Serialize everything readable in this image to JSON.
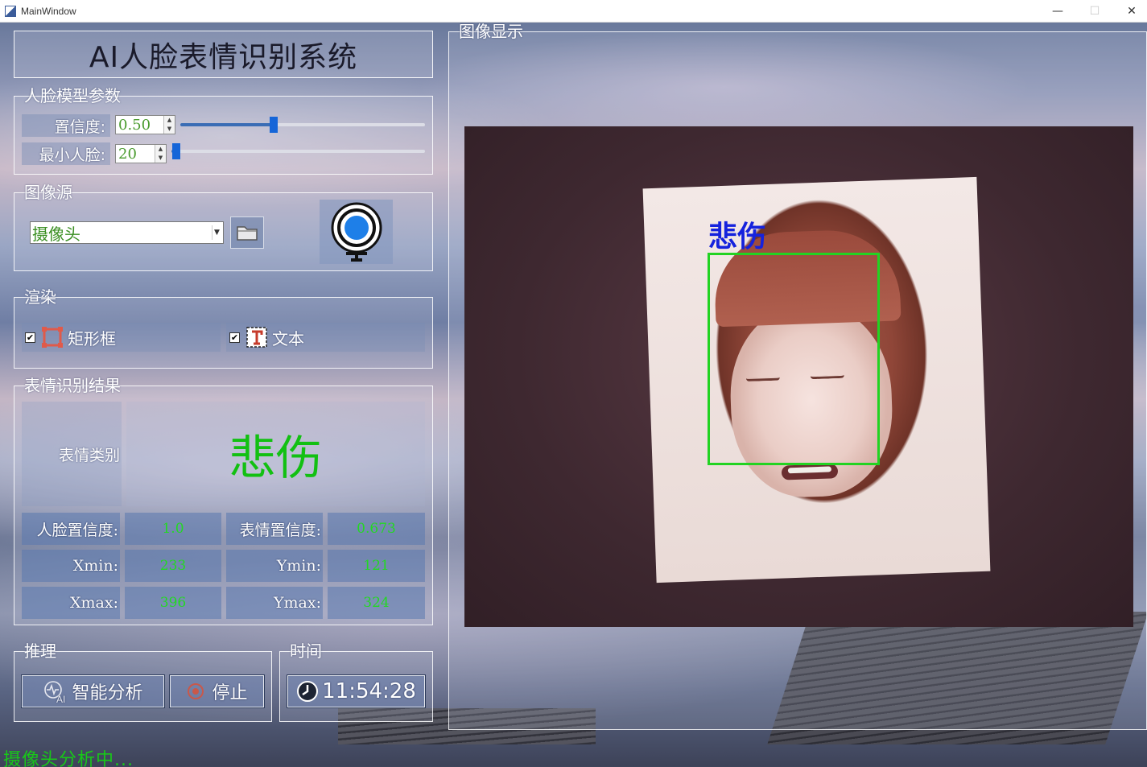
{
  "window": {
    "title": "MainWindow",
    "min": "—",
    "max": "☐",
    "close": "✕"
  },
  "app": {
    "headline": "AI人脸表情识别系统"
  },
  "model_params": {
    "title": "人脸模型参数",
    "confidence_label": "置信度:",
    "confidence_value": "0.50",
    "min_face_label": "最小人脸:",
    "min_face_value": "20",
    "confidence_slider": 0.38,
    "min_face_slider": 0.02
  },
  "source": {
    "title": "图像源",
    "selected": "摄像头"
  },
  "render": {
    "title": "渲染",
    "rect_label": "矩形框",
    "text_label": "文本",
    "rect_checked": "✔",
    "text_checked": "✔"
  },
  "result": {
    "title": "表情识别结果",
    "category_label": "表情类别",
    "category_value": "悲伤",
    "face_conf_label": "人脸置信度:",
    "face_conf_value": "1.0",
    "expr_conf_label": "表情置信度:",
    "expr_conf_value": "0.673",
    "xmin_label": "Xmin:",
    "xmin_value": "233",
    "ymin_label": "Ymin:",
    "ymin_value": "121",
    "xmax_label": "Xmax:",
    "xmax_value": "396",
    "ymax_label": "Ymax:",
    "ymax_value": "324"
  },
  "inference": {
    "title": "推理",
    "analyze_label": "智能分析",
    "stop_label": "停止"
  },
  "time": {
    "title": "时间",
    "value": "11:54:28"
  },
  "display": {
    "title": "图像显示",
    "detected_label": "悲伤"
  },
  "status": {
    "text": "摄像头分析中..."
  },
  "colors": {
    "accent_green": "#12c012",
    "box_green": "#22d322",
    "label_blue": "#1522dd",
    "slider_blue": "#1565d8"
  }
}
